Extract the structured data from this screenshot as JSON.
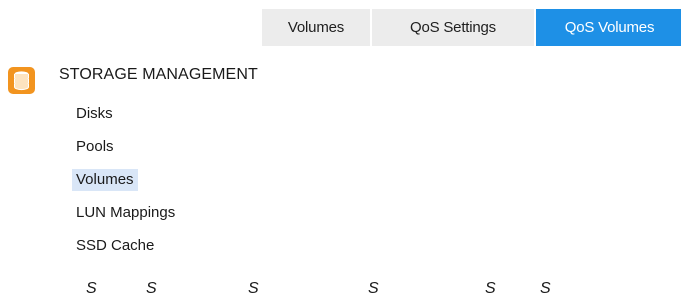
{
  "tabs": [
    {
      "label": "Volumes",
      "active": false
    },
    {
      "label": "QoS Settings",
      "active": false
    },
    {
      "label": "QoS Volumes",
      "active": true
    }
  ],
  "colors": {
    "active_tab": "#1e90e6",
    "inactive_tab": "#ececec",
    "section_icon": "#f2941f",
    "nav_highlight": "#d9e6f7"
  },
  "section": {
    "icon": "storage-database-icon",
    "title": "STORAGE MANAGEMENT",
    "items": [
      {
        "label": "Disks",
        "active": false
      },
      {
        "label": "Pools",
        "active": false
      },
      {
        "label": "Volumes",
        "active": true
      },
      {
        "label": "LUN Mappings",
        "active": false
      },
      {
        "label": "SSD Cache",
        "active": false
      }
    ]
  },
  "footer_letters": [
    "S",
    "S",
    "S",
    "S",
    "S",
    "S"
  ]
}
